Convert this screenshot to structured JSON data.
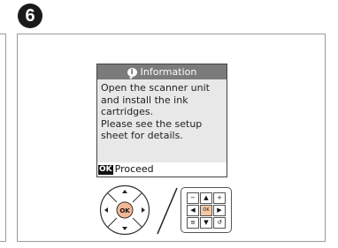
{
  "step": {
    "number": "6"
  },
  "screen": {
    "header": {
      "icon": "info-icon",
      "title": "Information"
    },
    "message_lines": [
      "Open the scanner unit",
      "and install the ink",
      "cartridges.",
      "Please see the setup",
      "sheet for details."
    ],
    "footer": {
      "ok_label": "OK",
      "action_label": "Proceed"
    }
  },
  "controls": {
    "dpad": {
      "center_label": "OK",
      "icons": [
        "arrow-up-icon",
        "arrow-down-icon",
        "arrow-left-icon",
        "arrow-right-icon"
      ]
    },
    "keypad": {
      "keys": [
        "−",
        "▲",
        "+",
        "◀",
        "OK",
        "▶",
        "≡",
        "▼",
        "↺"
      ]
    }
  },
  "colors": {
    "screen_header": "#7b7b7b",
    "screen_body": "#e8e8e8",
    "ok_key_highlight": "#f6c9a6",
    "ok_button_highlight": "#f4b896"
  }
}
